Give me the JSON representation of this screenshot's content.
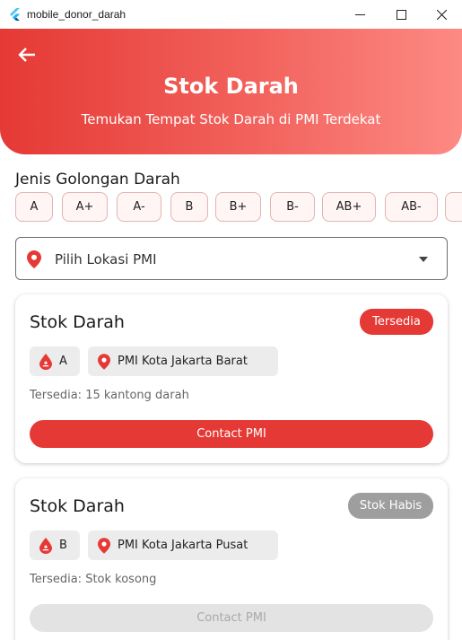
{
  "window": {
    "title": "mobile_donor_darah"
  },
  "header": {
    "title": "Stok Darah",
    "subtitle": "Temukan Tempat Stok Darah di PMI Terdekat"
  },
  "blood_types": {
    "label": "Jenis Golongan Darah",
    "options": [
      "A",
      "A+",
      "A-",
      "B",
      "B+",
      "B-",
      "AB+",
      "AB-"
    ]
  },
  "location": {
    "placeholder": "Pilih Lokasi PMI"
  },
  "cards": [
    {
      "title": "Stok Darah",
      "status": "Tersedia",
      "blood_type": "A",
      "location": "PMI Kota Jakarta Barat",
      "availability": "Tersedia: 15 kantong darah",
      "button": "Contact PMI"
    },
    {
      "title": "Stok Darah",
      "status": "Stok Habis",
      "blood_type": "B",
      "location": "PMI Kota Jakarta Pusat",
      "availability": "Tersedia: Stok kosong",
      "button": "Contact PMI"
    }
  ],
  "colors": {
    "primary": "#e53935",
    "muted": "#9e9e9e"
  }
}
